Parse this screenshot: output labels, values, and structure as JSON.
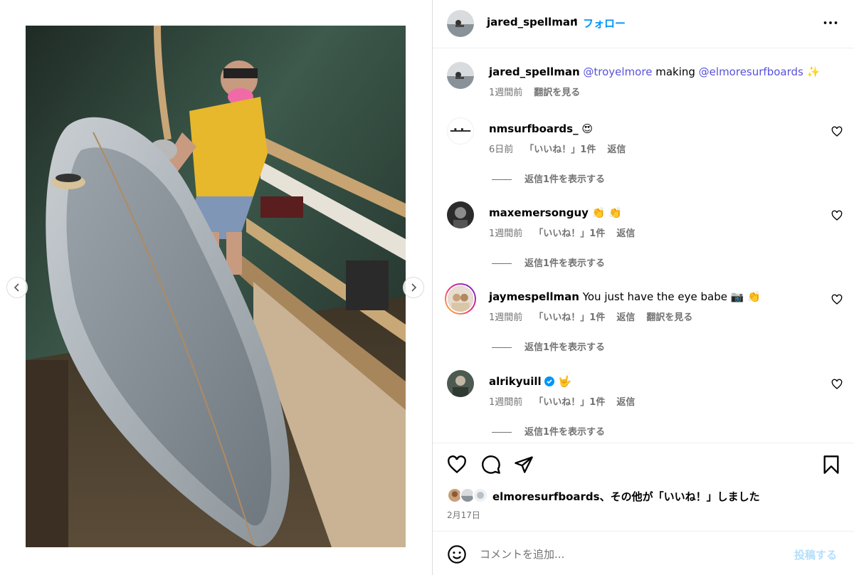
{
  "post": {
    "author": "jared_spellman",
    "separator": "•",
    "follow_label": "フォロー"
  },
  "caption": {
    "user": "jared_spellman",
    "mention1": "@troyelmore",
    "text_mid": " making ",
    "mention2": "@elmoresurfboards",
    "emoji": "✨",
    "time": "1週間前",
    "translate": "翻訳を見る"
  },
  "comments": [
    {
      "user": "nmsurfboards_",
      "text": "",
      "emoji": "😍",
      "time": "6日前",
      "likes": "「いいね！」1件",
      "reply": "返信",
      "translate": "",
      "replies": "返信1件を表示する"
    },
    {
      "user": "maxemersonguy",
      "text": "",
      "emoji": "👏 👏",
      "time": "1週間前",
      "likes": "「いいね！」1件",
      "reply": "返信",
      "translate": "",
      "replies": "返信1件を表示する"
    },
    {
      "user": "jaymespellman",
      "text": " You just have the eye babe ",
      "emoji": "📷 👏",
      "time": "1週間前",
      "likes": "「いいね！」1件",
      "reply": "返信",
      "translate": "翻訳を見る",
      "replies": "返信1件を表示する"
    },
    {
      "user": "alrikyuill",
      "text": "",
      "emoji": "🤟",
      "time": "1週間前",
      "likes": "「いいね！」1件",
      "reply": "返信",
      "translate": "",
      "replies": "返信1件を表示する"
    }
  ],
  "likes_summary": "elmoresurfboards、その他が「いいね！」しました",
  "date": "2月17日",
  "add_comment": {
    "placeholder": "コメントを追加...",
    "post_label": "投稿する"
  },
  "icons": {
    "like": "heart-icon",
    "comment": "comment-icon",
    "share": "share-icon",
    "save": "bookmark-icon",
    "more": "more-icon",
    "emoji": "emoji-icon",
    "verified": "verified-badge-icon",
    "prev": "chevron-left-icon",
    "next": "chevron-right-icon"
  },
  "colors": {
    "link_blue": "#0095f6",
    "mention": "#5851db",
    "muted": "#737373",
    "post_disabled": "#b2dffc",
    "verified": "#0095f6"
  }
}
